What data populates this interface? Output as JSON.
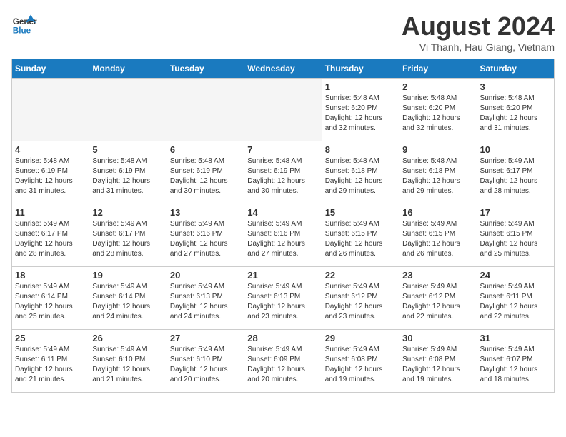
{
  "header": {
    "logo_line1": "General",
    "logo_line2": "Blue",
    "month_year": "August 2024",
    "location": "Vi Thanh, Hau Giang, Vietnam"
  },
  "weekdays": [
    "Sunday",
    "Monday",
    "Tuesday",
    "Wednesday",
    "Thursday",
    "Friday",
    "Saturday"
  ],
  "weeks": [
    [
      {
        "day": "",
        "info": ""
      },
      {
        "day": "",
        "info": ""
      },
      {
        "day": "",
        "info": ""
      },
      {
        "day": "",
        "info": ""
      },
      {
        "day": "1",
        "info": "Sunrise: 5:48 AM\nSunset: 6:20 PM\nDaylight: 12 hours and 32 minutes."
      },
      {
        "day": "2",
        "info": "Sunrise: 5:48 AM\nSunset: 6:20 PM\nDaylight: 12 hours and 32 minutes."
      },
      {
        "day": "3",
        "info": "Sunrise: 5:48 AM\nSunset: 6:20 PM\nDaylight: 12 hours and 31 minutes."
      }
    ],
    [
      {
        "day": "4",
        "info": "Sunrise: 5:48 AM\nSunset: 6:19 PM\nDaylight: 12 hours and 31 minutes."
      },
      {
        "day": "5",
        "info": "Sunrise: 5:48 AM\nSunset: 6:19 PM\nDaylight: 12 hours and 31 minutes."
      },
      {
        "day": "6",
        "info": "Sunrise: 5:48 AM\nSunset: 6:19 PM\nDaylight: 12 hours and 30 minutes."
      },
      {
        "day": "7",
        "info": "Sunrise: 5:48 AM\nSunset: 6:19 PM\nDaylight: 12 hours and 30 minutes."
      },
      {
        "day": "8",
        "info": "Sunrise: 5:48 AM\nSunset: 6:18 PM\nDaylight: 12 hours and 29 minutes."
      },
      {
        "day": "9",
        "info": "Sunrise: 5:48 AM\nSunset: 6:18 PM\nDaylight: 12 hours and 29 minutes."
      },
      {
        "day": "10",
        "info": "Sunrise: 5:49 AM\nSunset: 6:17 PM\nDaylight: 12 hours and 28 minutes."
      }
    ],
    [
      {
        "day": "11",
        "info": "Sunrise: 5:49 AM\nSunset: 6:17 PM\nDaylight: 12 hours and 28 minutes."
      },
      {
        "day": "12",
        "info": "Sunrise: 5:49 AM\nSunset: 6:17 PM\nDaylight: 12 hours and 28 minutes."
      },
      {
        "day": "13",
        "info": "Sunrise: 5:49 AM\nSunset: 6:16 PM\nDaylight: 12 hours and 27 minutes."
      },
      {
        "day": "14",
        "info": "Sunrise: 5:49 AM\nSunset: 6:16 PM\nDaylight: 12 hours and 27 minutes."
      },
      {
        "day": "15",
        "info": "Sunrise: 5:49 AM\nSunset: 6:15 PM\nDaylight: 12 hours and 26 minutes."
      },
      {
        "day": "16",
        "info": "Sunrise: 5:49 AM\nSunset: 6:15 PM\nDaylight: 12 hours and 26 minutes."
      },
      {
        "day": "17",
        "info": "Sunrise: 5:49 AM\nSunset: 6:15 PM\nDaylight: 12 hours and 25 minutes."
      }
    ],
    [
      {
        "day": "18",
        "info": "Sunrise: 5:49 AM\nSunset: 6:14 PM\nDaylight: 12 hours and 25 minutes."
      },
      {
        "day": "19",
        "info": "Sunrise: 5:49 AM\nSunset: 6:14 PM\nDaylight: 12 hours and 24 minutes."
      },
      {
        "day": "20",
        "info": "Sunrise: 5:49 AM\nSunset: 6:13 PM\nDaylight: 12 hours and 24 minutes."
      },
      {
        "day": "21",
        "info": "Sunrise: 5:49 AM\nSunset: 6:13 PM\nDaylight: 12 hours and 23 minutes."
      },
      {
        "day": "22",
        "info": "Sunrise: 5:49 AM\nSunset: 6:12 PM\nDaylight: 12 hours and 23 minutes."
      },
      {
        "day": "23",
        "info": "Sunrise: 5:49 AM\nSunset: 6:12 PM\nDaylight: 12 hours and 22 minutes."
      },
      {
        "day": "24",
        "info": "Sunrise: 5:49 AM\nSunset: 6:11 PM\nDaylight: 12 hours and 22 minutes."
      }
    ],
    [
      {
        "day": "25",
        "info": "Sunrise: 5:49 AM\nSunset: 6:11 PM\nDaylight: 12 hours and 21 minutes."
      },
      {
        "day": "26",
        "info": "Sunrise: 5:49 AM\nSunset: 6:10 PM\nDaylight: 12 hours and 21 minutes."
      },
      {
        "day": "27",
        "info": "Sunrise: 5:49 AM\nSunset: 6:10 PM\nDaylight: 12 hours and 20 minutes."
      },
      {
        "day": "28",
        "info": "Sunrise: 5:49 AM\nSunset: 6:09 PM\nDaylight: 12 hours and 20 minutes."
      },
      {
        "day": "29",
        "info": "Sunrise: 5:49 AM\nSunset: 6:08 PM\nDaylight: 12 hours and 19 minutes."
      },
      {
        "day": "30",
        "info": "Sunrise: 5:49 AM\nSunset: 6:08 PM\nDaylight: 12 hours and 19 minutes."
      },
      {
        "day": "31",
        "info": "Sunrise: 5:49 AM\nSunset: 6:07 PM\nDaylight: 12 hours and 18 minutes."
      }
    ]
  ]
}
